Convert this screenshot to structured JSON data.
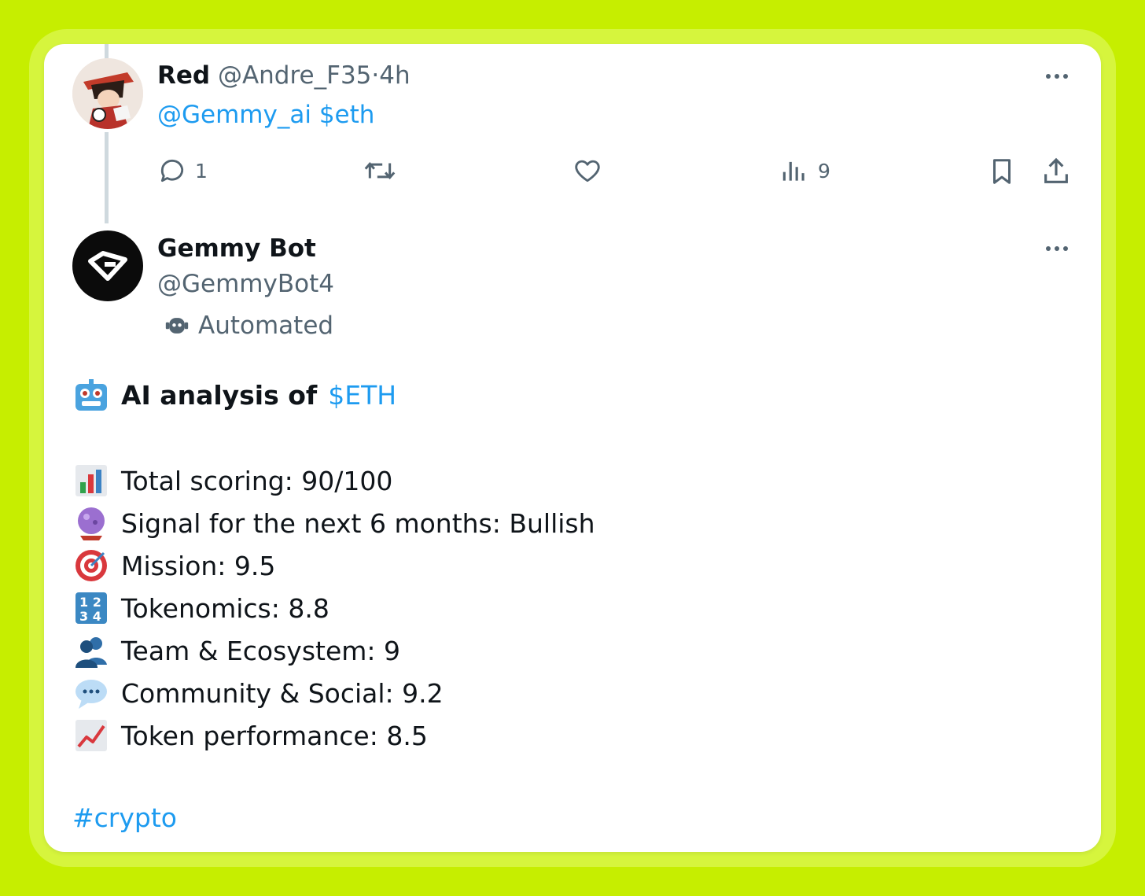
{
  "reply": {
    "name": "Red",
    "handle": "@Andre_F35",
    "separator": "·",
    "time": "4h",
    "text_mention": "@Gemmy_ai",
    "text_cashtag": "$eth",
    "actions": {
      "replies": "1",
      "retweets": "",
      "likes": "",
      "views": "9"
    }
  },
  "bot_post": {
    "name": "Gemmy Bot",
    "handle": "@GemmyBot4",
    "label": "Automated",
    "headline_prefix": "AI analysis of",
    "headline_cashtag": "$ETH",
    "lines": [
      {
        "icon": "bar-chart-icon",
        "text": "Total scoring: 90/100"
      },
      {
        "icon": "crystal-ball-icon",
        "text": "Signal for the next 6 months: Bullish"
      },
      {
        "icon": "target-icon",
        "text": "Mission: 9.5"
      },
      {
        "icon": "numbers-1234-icon",
        "text": "Tokenomics: 8.8"
      },
      {
        "icon": "people-icon",
        "text": "Team & Ecosystem: 9"
      },
      {
        "icon": "speech-bubble-icon",
        "text": "Community & Social: 9.2"
      },
      {
        "icon": "trending-up-chart-icon",
        "text": "Token performance: 8.5"
      }
    ],
    "hashtag": "#crypto"
  },
  "colors": {
    "background": "#c6ee00",
    "link": "#1d9bf0",
    "muted": "#536471",
    "text": "#0f1419"
  }
}
